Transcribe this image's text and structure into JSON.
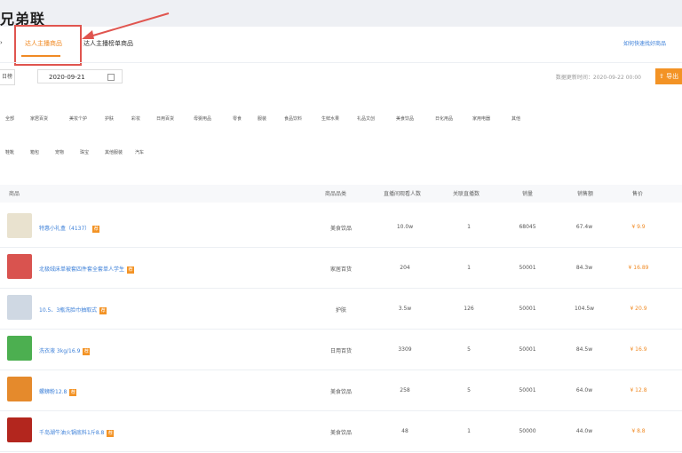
{
  "header": {
    "brand": "兄弟联"
  },
  "tabs": [
    {
      "label": "达人主播商品"
    },
    {
      "label": "达人主播榜单商品"
    }
  ],
  "right_link": "如何快速找好商品",
  "filters": {
    "range_label": "日榜",
    "date_value": "2020-09-21",
    "update_time": "数据更新时间：2020-09-22 00:00",
    "export_label": "导出"
  },
  "categories_row1": [
    "全部",
    "家居百货",
    "美妆个护",
    "护肤",
    "彩妆",
    "日用百货",
    "母婴用品",
    "零食",
    "服装",
    "食品饮料",
    "生鲜水果",
    "礼品文创",
    "美食饮品",
    "日化用品",
    "家用电器",
    "其他"
  ],
  "categories_row2": [
    "鞋靴",
    "箱包",
    "宠物",
    "珠宝",
    "其他服装",
    "汽车"
  ],
  "table": {
    "headers": [
      "商品",
      "商品品类",
      "直播间观看人数",
      "关联直播数",
      "销量",
      "销售额",
      "售价"
    ],
    "rows": [
      {
        "name": "特惠小礼盒（4137）",
        "category": "美食饮品",
        "viewers": "10.0w",
        "live_count": "1",
        "sales": "68045",
        "amount": "67.4w",
        "price": "¥ 9.9",
        "thumb_color": "#e9e2cf"
      },
      {
        "name": "北极绒床单被套四件套全套单人学生",
        "category": "家居百货",
        "viewers": "204",
        "live_count": "1",
        "sales": "50001",
        "amount": "84.3w",
        "price": "¥ 16.89",
        "thumb_color": "#d9534f"
      },
      {
        "name": "10.5、3瓶洗脸巾抽取式",
        "category": "护肤",
        "viewers": "3.5w",
        "live_count": "126",
        "sales": "50001",
        "amount": "104.5w",
        "price": "¥ 20.9",
        "thumb_color": "#cfd8e3"
      },
      {
        "name": "洗衣液 3kg/16.9",
        "category": "日用百货",
        "viewers": "3309",
        "live_count": "5",
        "sales": "50001",
        "amount": "84.5w",
        "price": "¥ 16.9",
        "thumb_color": "#4caf50"
      },
      {
        "name": "螺蛳粉12.8",
        "category": "美食饮品",
        "viewers": "258",
        "live_count": "5",
        "sales": "50001",
        "amount": "64.0w",
        "price": "¥ 12.8",
        "thumb_color": "#e58a2c"
      },
      {
        "name": "千岛湖牛油火锅底料1斤8.8",
        "category": "美食饮品",
        "viewers": "48",
        "live_count": "1",
        "sales": "50000",
        "amount": "44.0w",
        "price": "¥ 8.8",
        "thumb_color": "#b3261e"
      }
    ]
  },
  "colors": {
    "accent": "#f08a24",
    "link": "#3b7fd8",
    "highlight": "#e0554f"
  }
}
